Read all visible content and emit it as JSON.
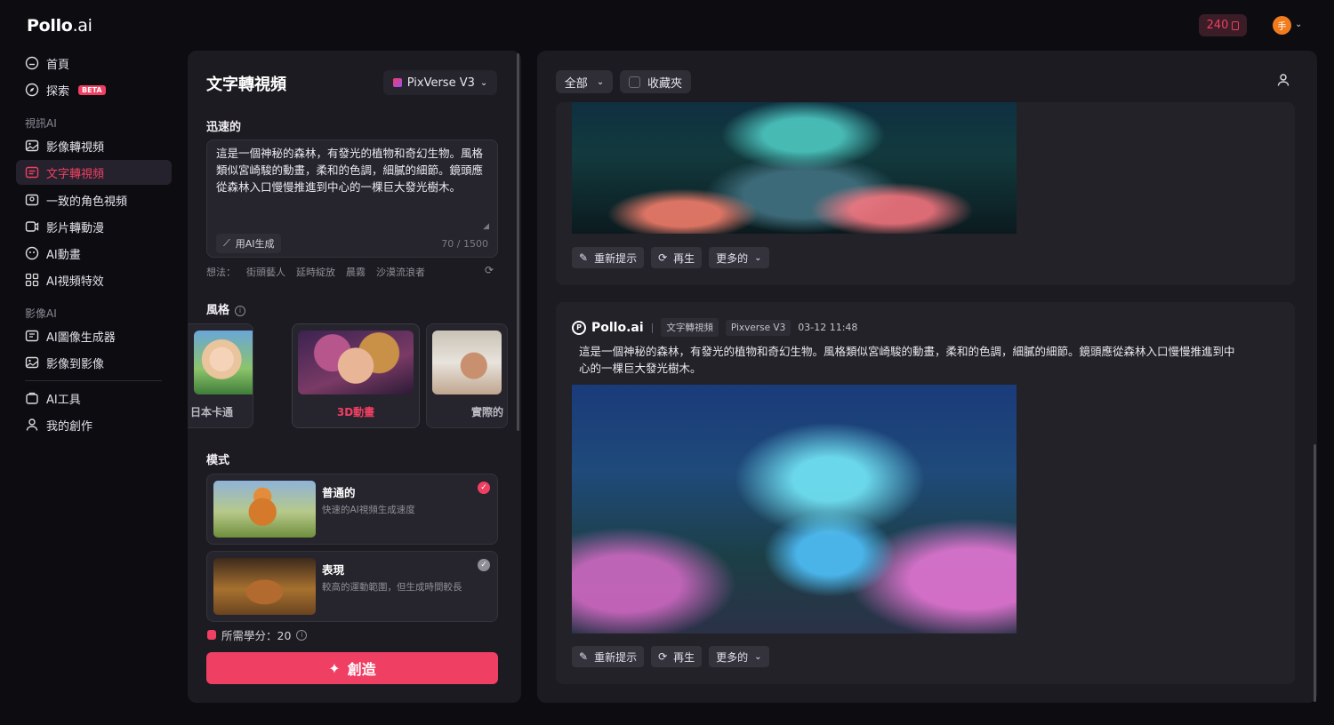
{
  "app": {
    "logo_bold": "Pollo",
    "logo_light": ".ai"
  },
  "header": {
    "credits": "240",
    "avatar_initial": "手"
  },
  "sidebar": {
    "home": "首頁",
    "explore": "探索",
    "beta": "BETA",
    "section_video": "視訊AI",
    "image_to_video": "影像轉視頻",
    "text_to_video": "文字轉視頻",
    "consistent_character": "一致的角色視頻",
    "video_to_anime": "影片轉動漫",
    "ai_animation": "AI動畫",
    "ai_video_effects": "AI視頻特效",
    "section_image": "影像AI",
    "ai_image_generator": "AI圖像生成器",
    "image_to_image": "影像到影像",
    "ai_tools": "AI工具",
    "my_creations": "我的創作"
  },
  "left": {
    "title": "文字轉視頻",
    "model": "PixVerse V3",
    "quick_label": "迅速的",
    "prompt": "這是一個神秘的森林，有發光的植物和奇幻生物。風格類似宮崎駿的動畫，柔和的色調，細膩的細節。鏡頭應從森林入口慢慢推進到中心的一棵巨大發光樹木。",
    "ai_generate": "用AI生成",
    "counter": "70 / 1500",
    "ideas_label": "想法：",
    "ideas": [
      "街頭藝人",
      "延時綻放",
      "晨霧",
      "沙漠流浪者"
    ],
    "style_label": "風格",
    "styles": [
      "日本卡通",
      "3D動畫",
      "實際的"
    ],
    "mode_label": "模式",
    "mode_normal_title": "普通的",
    "mode_normal_desc": "快速的AI視頻生成速度",
    "mode_perf_title": "表現",
    "mode_perf_desc": "較高的運動範圍，但生成時間較長",
    "credits_needed": "所需學分：20",
    "create": "創造"
  },
  "right": {
    "filter_all": "全部",
    "filter_fav": "收藏夾",
    "reprompt": "重新提示",
    "regenerate": "再生",
    "more": "更多的",
    "card2": {
      "brand": "Pollo.ai",
      "sep": "|",
      "tag_type": "文字轉視頻",
      "tag_model": "Pixverse V3",
      "time": "03-12 11:48",
      "text": "這是一個神秘的森林，有發光的植物和奇幻生物。風格類似宮崎駿的動畫，柔和的色調，細膩的細節。鏡頭應從森林入口慢慢推進到中心的一棵巨大發光樹木。"
    }
  },
  "colors": {
    "accent": "#ef3f63",
    "bg": "#0d0c11",
    "panel": "#1c1b21"
  }
}
